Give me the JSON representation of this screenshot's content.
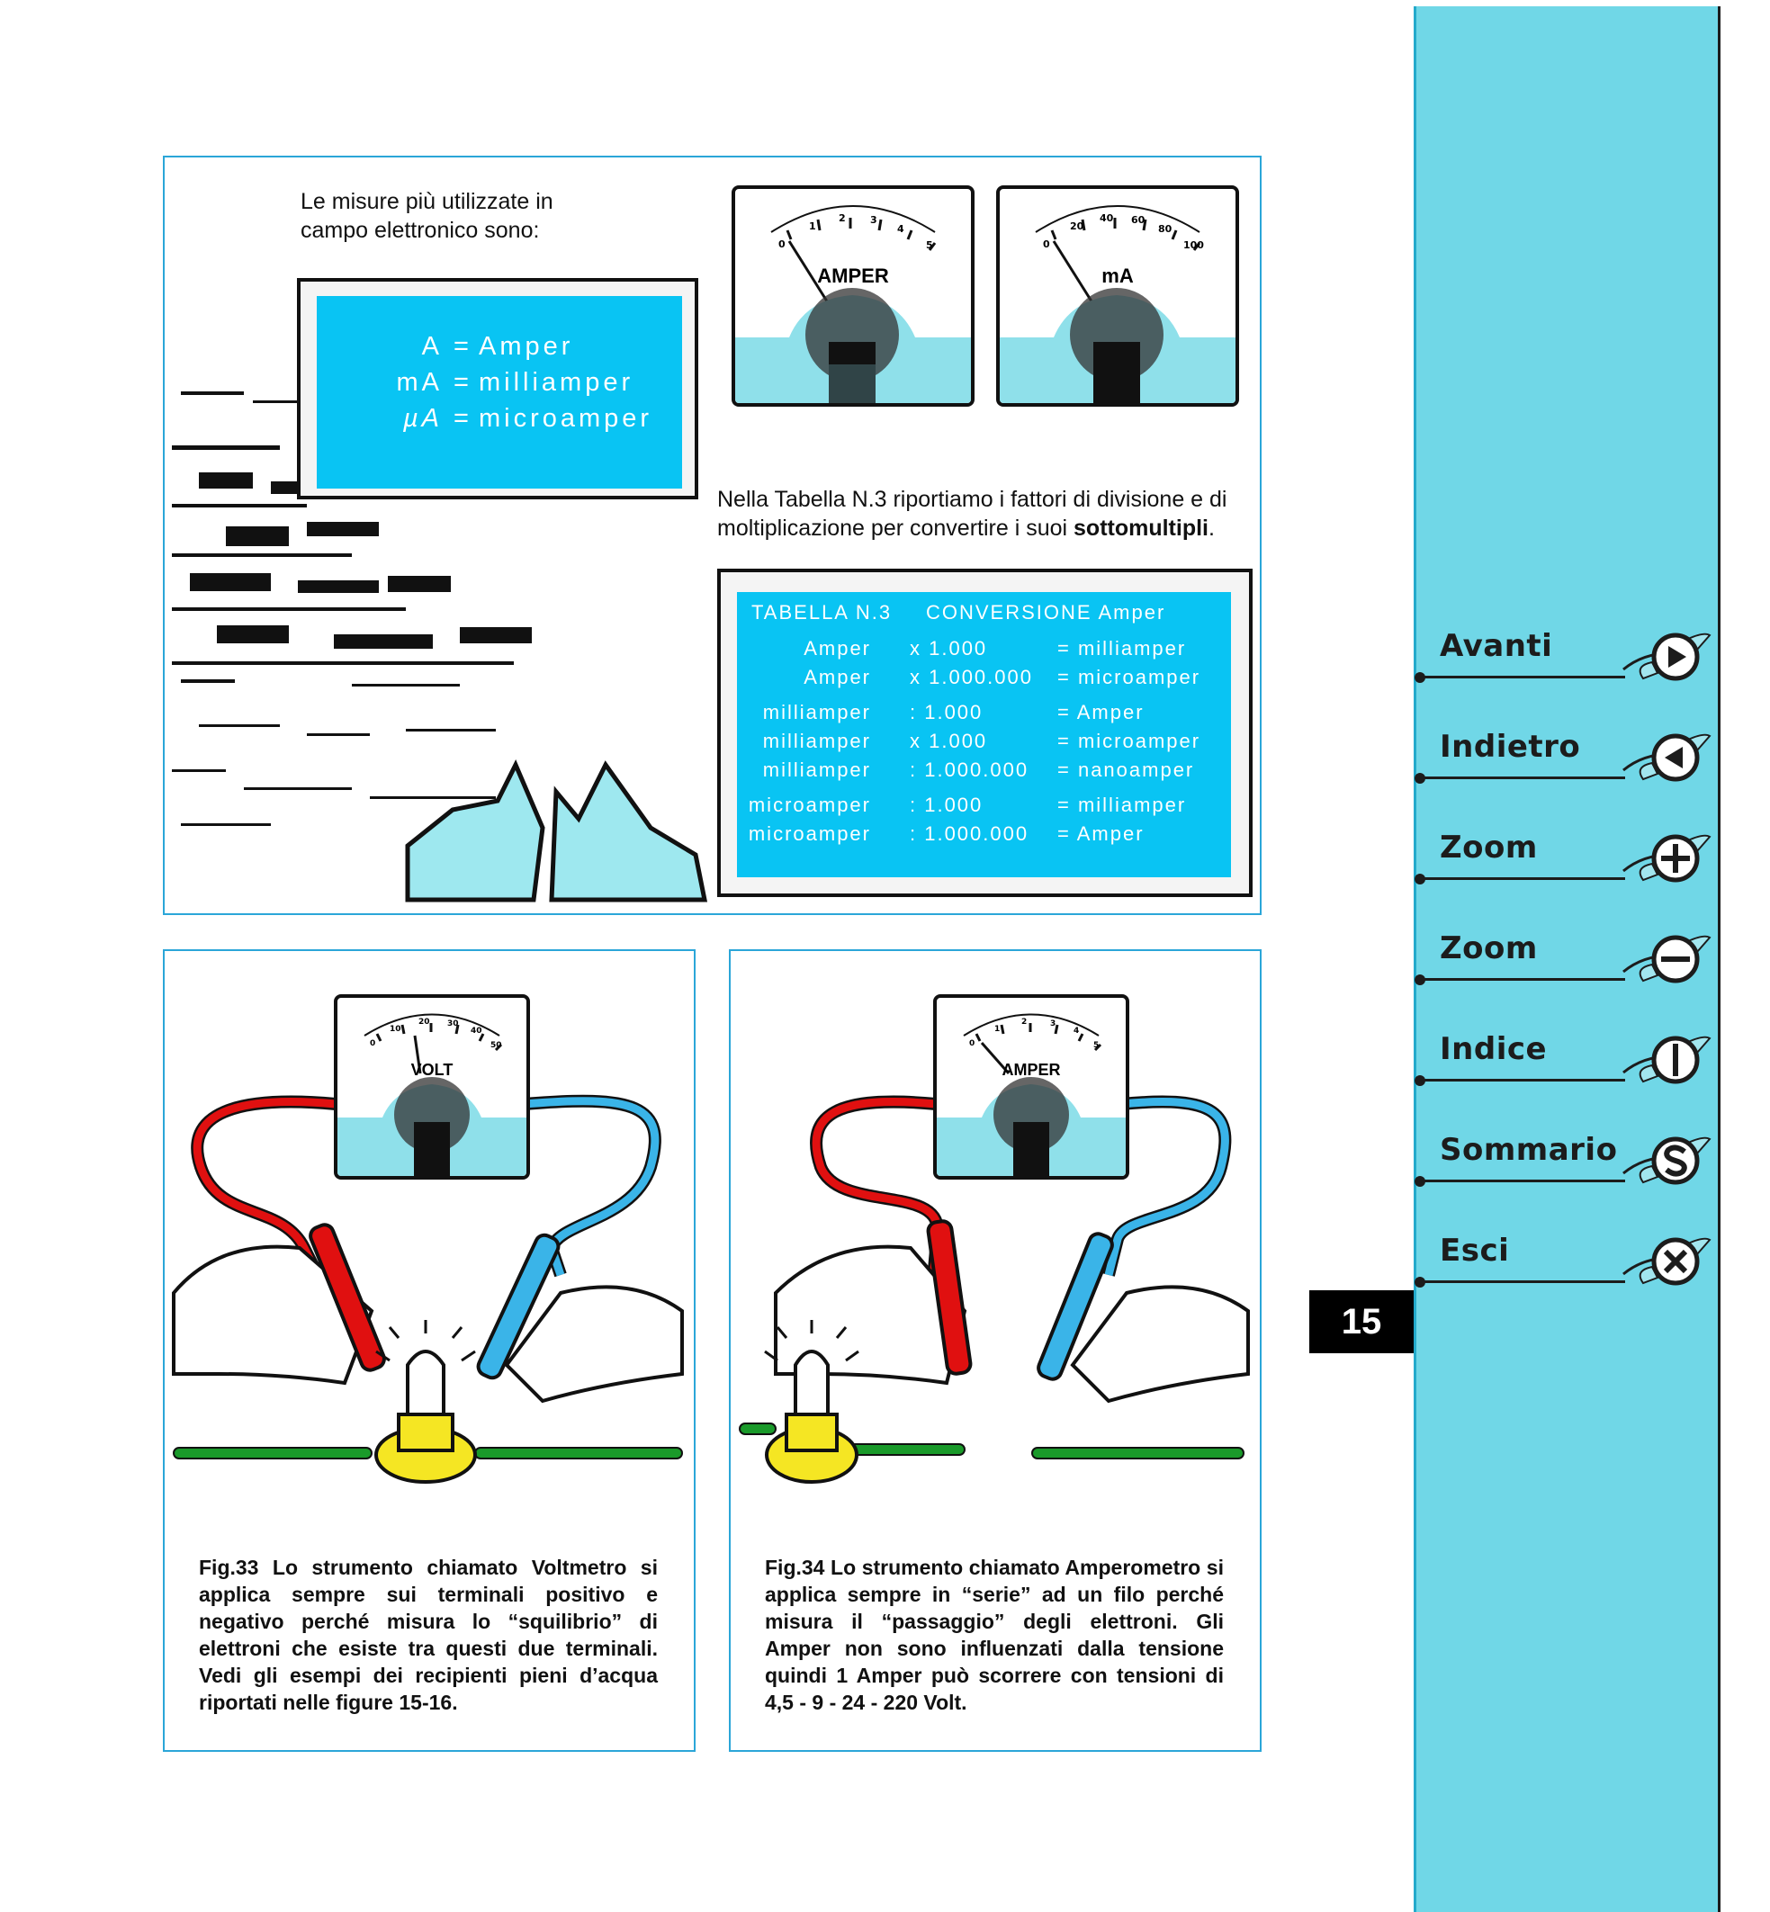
{
  "intro": {
    "line1": "Le misure più utilizzate in",
    "line2": "campo elettronico sono:"
  },
  "units": [
    {
      "symbol": "A",
      "eq": "=",
      "name": "Amper"
    },
    {
      "symbol": "mA",
      "eq": "=",
      "name": "milliamper"
    },
    {
      "symbol": "µA",
      "eq": "=",
      "name": "microamper"
    }
  ],
  "meters": {
    "top_left": {
      "label": "AMPER",
      "ticks": [
        "0",
        "1",
        "2",
        "3",
        "4",
        "5"
      ]
    },
    "top_right": {
      "label": "mA",
      "ticks": [
        "0",
        "20",
        "40",
        "60",
        "80",
        "100"
      ]
    },
    "fig33": {
      "label": "VOLT",
      "ticks": [
        "0",
        "10",
        "20",
        "30",
        "40",
        "50"
      ]
    },
    "fig34": {
      "label": "AMPER",
      "ticks": [
        "0",
        "1",
        "2",
        "3",
        "4",
        "5"
      ]
    }
  },
  "table_note": {
    "line1": "Nella Tabella N.3 riportiamo i fattori di divisione e di",
    "line2_pre": "moltiplicazione per convertire i suoi ",
    "line2_bold": "sottomultipli",
    "line2_post": "."
  },
  "table": {
    "title": "TABELLA N.3",
    "subtitle": "CONVERSIONE  Amper",
    "groups": [
      [
        {
          "from": "Amper",
          "op": "x 1.000",
          "to": "= milliamper"
        },
        {
          "from": "Amper",
          "op": "x 1.000.000",
          "to": "= microamper"
        }
      ],
      [
        {
          "from": "milliamper",
          "op": ": 1.000",
          "to": "= Amper"
        },
        {
          "from": "milliamper",
          "op": "x 1.000",
          "to": "= microamper"
        },
        {
          "from": "milliamper",
          "op": ": 1.000.000",
          "to": "= nanoamper"
        }
      ],
      [
        {
          "from": "microamper",
          "op": ": 1.000",
          "to": "= milliamper"
        },
        {
          "from": "microamper",
          "op": ": 1.000.000",
          "to": "= Amper"
        }
      ]
    ]
  },
  "captions": {
    "fig33": "Fig.33 Lo strumento chiamato Voltmetro si applica sempre sui terminali positivo e negativo perché misura lo “squilibrio” di elettroni che esiste tra questi due terminali. Vedi gli esempi dei recipienti pieni d’acqua riportati nelle figure 15-16.",
    "fig34": "Fig.34 Lo strumento chiamato Amperometro si applica sempre in “serie” ad un filo perché misura il “passaggio” degli elettroni. Gli Amper non sono influenzati dalla tensione quindi 1 Amper può scorrere con tensioni di 4,5 - 9 - 24 - 220 Volt."
  },
  "page_number": "15",
  "nav": [
    {
      "label": "Avanti",
      "icon": "play-right-icon"
    },
    {
      "label": "Indietro",
      "icon": "play-left-icon"
    },
    {
      "label": "Zoom",
      "icon": "zoom-in-plus-icon"
    },
    {
      "label": "Zoom",
      "icon": "zoom-out-minus-icon"
    },
    {
      "label": "Indice",
      "icon": "index-bar-icon"
    },
    {
      "label": "Sommario",
      "icon": "summary-s-icon"
    },
    {
      "label": "Esci",
      "icon": "exit-x-icon"
    }
  ],
  "colors": {
    "sidebar": "#70d7e7",
    "board_blue": "#09c4f3",
    "panel_border": "#2ba6d8",
    "wire_red": "#e01010",
    "wire_blue": "#3ab4e8",
    "wire_green": "#1a9a2a",
    "bulb_yellow": "#f5e623"
  }
}
